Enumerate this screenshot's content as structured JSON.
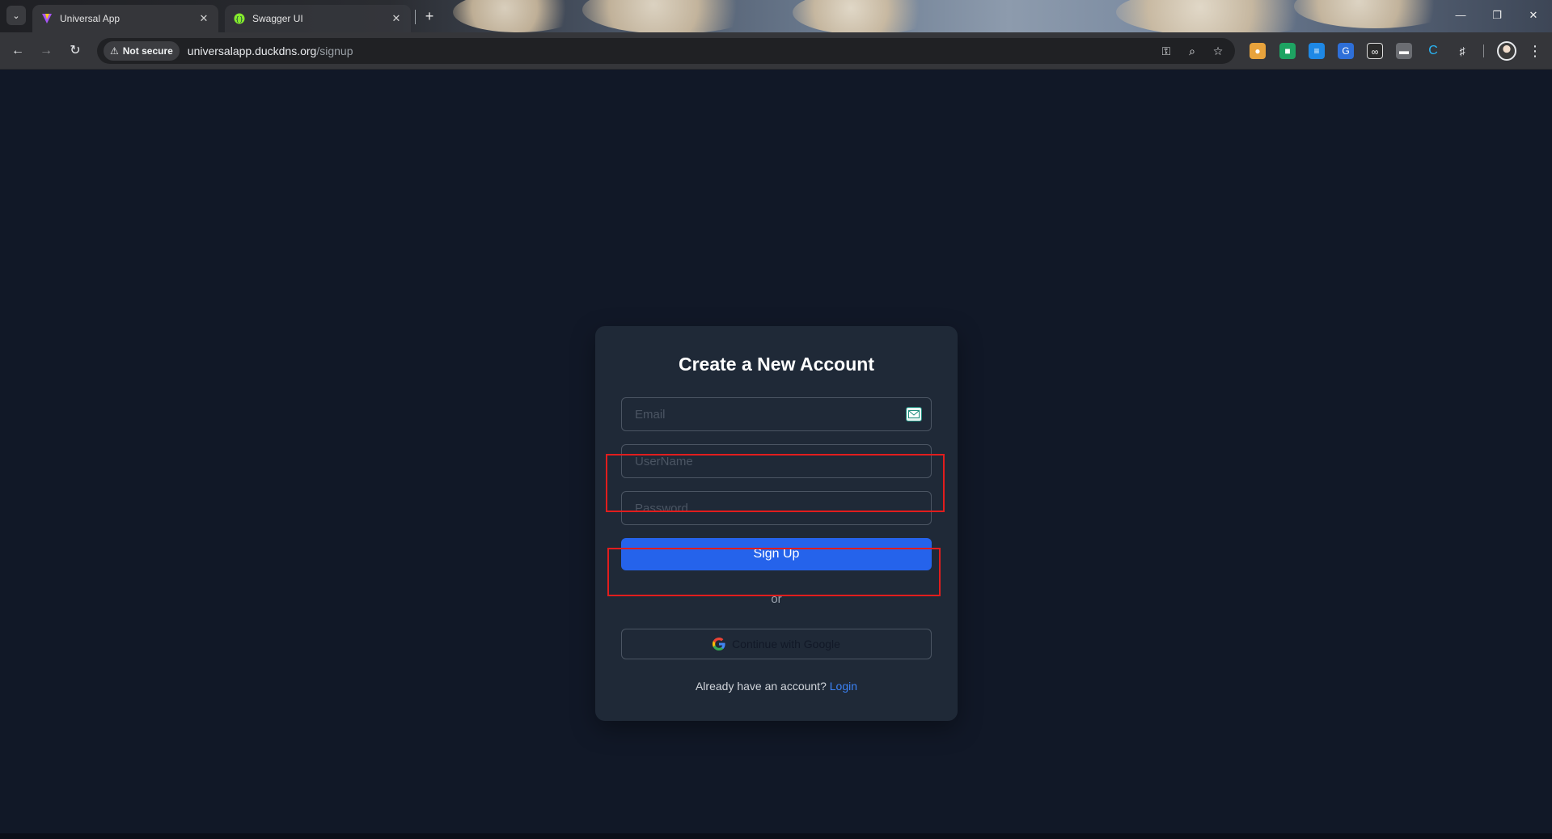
{
  "browser": {
    "tabs": [
      {
        "title": "Universal App",
        "active": true,
        "favicon": "vite-logo-icon"
      },
      {
        "title": "Swagger UI",
        "active": false,
        "favicon": "swagger-logo-icon"
      }
    ],
    "security_label": "Not secure",
    "url_host": "universalapp.duckdns.org",
    "url_path": "/signup"
  },
  "signup": {
    "title": "Create a New Account",
    "email_placeholder": "Email",
    "username_placeholder": "UserName",
    "password_placeholder": "Password",
    "signup_button": "Sign Up",
    "divider": "or",
    "google_button": "Continue with Google",
    "login_prompt": "Already have an account?",
    "login_link": "Login"
  },
  "colors": {
    "page_bg": "#111827",
    "card_bg": "#1f2937",
    "primary": "#2563eb",
    "link": "#3b82f6",
    "highlight": "#e11d1d"
  }
}
